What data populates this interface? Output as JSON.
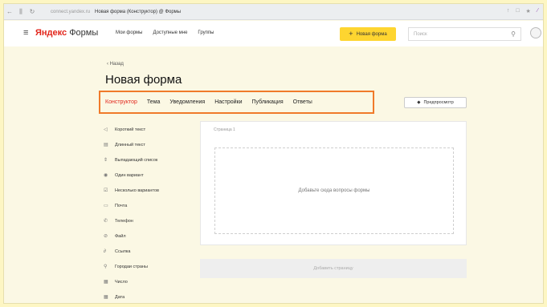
{
  "browser": {
    "back": "←",
    "forward": "⫼",
    "reload": "↻",
    "url": "connect.yandex.ru",
    "tab_title": "Новая форма (Конструктор) @ Формы",
    "icons": [
      "↑",
      "□",
      "★",
      "⁄"
    ]
  },
  "header": {
    "burger": "≡",
    "logo_brand": "Яндекс",
    "logo_product": " Формы",
    "nav": [
      "Мои формы",
      "Доступные мне",
      "Группы"
    ],
    "new_form_label": "Новая форма",
    "search_placeholder": "Поиск"
  },
  "page": {
    "back_label": "‹ Назад",
    "title": "Новая форма",
    "tabs": [
      "Конструктор",
      "Тема",
      "Уведомления",
      "Настройки",
      "Публикация",
      "Ответы"
    ],
    "preview_label": "Предпросмотр"
  },
  "field_types": [
    {
      "icon": "◁",
      "label": "Короткий текст"
    },
    {
      "icon": "▤",
      "label": "Длинный текст"
    },
    {
      "icon": "⇕",
      "label": "Выпадающий список"
    },
    {
      "icon": "◉",
      "label": "Один вариант"
    },
    {
      "icon": "☑",
      "label": "Несколько вариантов"
    },
    {
      "icon": "▭",
      "label": "Почта"
    },
    {
      "icon": "✆",
      "label": "Телефон"
    },
    {
      "icon": "⊘",
      "label": "Файл"
    },
    {
      "icon": "∂",
      "label": "Ссылка"
    },
    {
      "icon": "⚲",
      "label": "Городаи страны"
    },
    {
      "icon": "▦",
      "label": "Число"
    },
    {
      "icon": "▦",
      "label": "Дата"
    }
  ],
  "canvas": {
    "page_label": "Страница 1",
    "drop_hint": "Добавьте сюда вопросы формы",
    "add_page_label": "Добавить страницу"
  },
  "colors": {
    "accent_yellow": "#fed530",
    "active_tab": "#e2261c",
    "highlight_border": "#f07a2a",
    "background": "#fdf6c3"
  }
}
